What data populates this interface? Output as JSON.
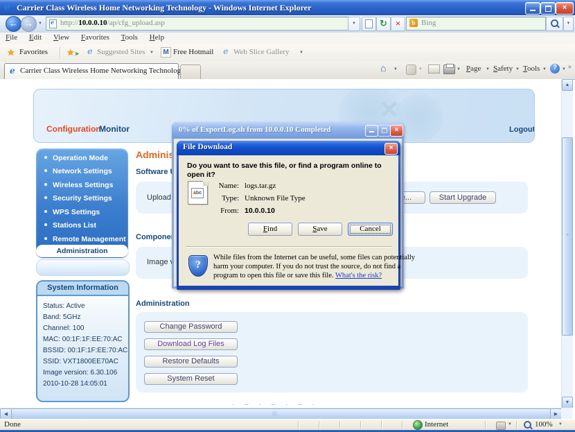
{
  "browser": {
    "title": "Carrier Class Wireless Home Networking Technology - Windows Internet Explorer",
    "menu_items": [
      "File",
      "Edit",
      "View",
      "Favorites",
      "Tools",
      "Help"
    ],
    "url": {
      "prefix": "http://",
      "domain": "10.0.0.10",
      "path": "/ap/cfg_upload.asp"
    },
    "search": {
      "engine": "Bing"
    },
    "favorites_bar": {
      "favorites": "Favorites",
      "suggested_sites": "Suggested Sites",
      "free_hotmail": "Free Hotmail",
      "web_slice_gallery": "Web Slice Gallery"
    },
    "tab_title": "Carrier Class Wireless Home Networking Technology",
    "command_bar": {
      "page": "Page",
      "safety": "Safety",
      "tools": "Tools"
    },
    "status_bar": {
      "status": "Done",
      "zone": "Internet",
      "zoom_level": "100%"
    }
  },
  "page": {
    "header": {
      "tab_configuration": "Configuration",
      "tab_monitor": "Monitor",
      "logout": "Logout"
    },
    "sidebar": {
      "items": [
        "Operation Mode",
        "Network Settings",
        "Wireless Settings",
        "Security Settings",
        "WPS Settings",
        "Stations List",
        "Remote Management"
      ],
      "active_item": "Administration"
    },
    "system_info": {
      "title": "System Information",
      "rows": [
        "Status: Active",
        "Band: 5GHz",
        "Channel: 100",
        "MAC: 00:1F:1F:EE:70:AC",
        "BSSID: 00:1F:1F:EE:70:AC",
        "SSID: VXT1800EE70AC",
        "Image version: 6.30.106",
        "2010-10-28 14:05:01"
      ]
    },
    "main": {
      "heading": "Administration",
      "software_label": "Software Upgrade",
      "upload_row_label": "Upload File",
      "browse_button": "Browse...",
      "start_upgrade_button": "Start Upgrade",
      "components_label": "Components",
      "image_row_label": "Image version",
      "admin_label": "Administration",
      "buttons": [
        "Change Password",
        "Download Log Files",
        "Restore Defaults",
        "System Reset"
      ]
    }
  },
  "progress_window": {
    "title": "0% of ExportLog.sh from 10.0.0.10 Completed"
  },
  "dialog": {
    "title": "File Download",
    "question": "Do you want to save this file, or find a program online to open it?",
    "fields": [
      {
        "label": "Name:",
        "value": "logs.tar.gz"
      },
      {
        "label": "Type:",
        "value": "Unknown File Type"
      },
      {
        "label": "From:",
        "value": "10.0.0.10"
      }
    ],
    "buttons": [
      "Find",
      "Save",
      "Cancel"
    ],
    "warning_line1": "While files from the Internet can be useful, some files can potentially",
    "warning_line2": "harm your computer. If you do not trust the source, do not find a",
    "warning_line3": "program to open this file or save this file.",
    "risk_link": "What's the risk?"
  }
}
